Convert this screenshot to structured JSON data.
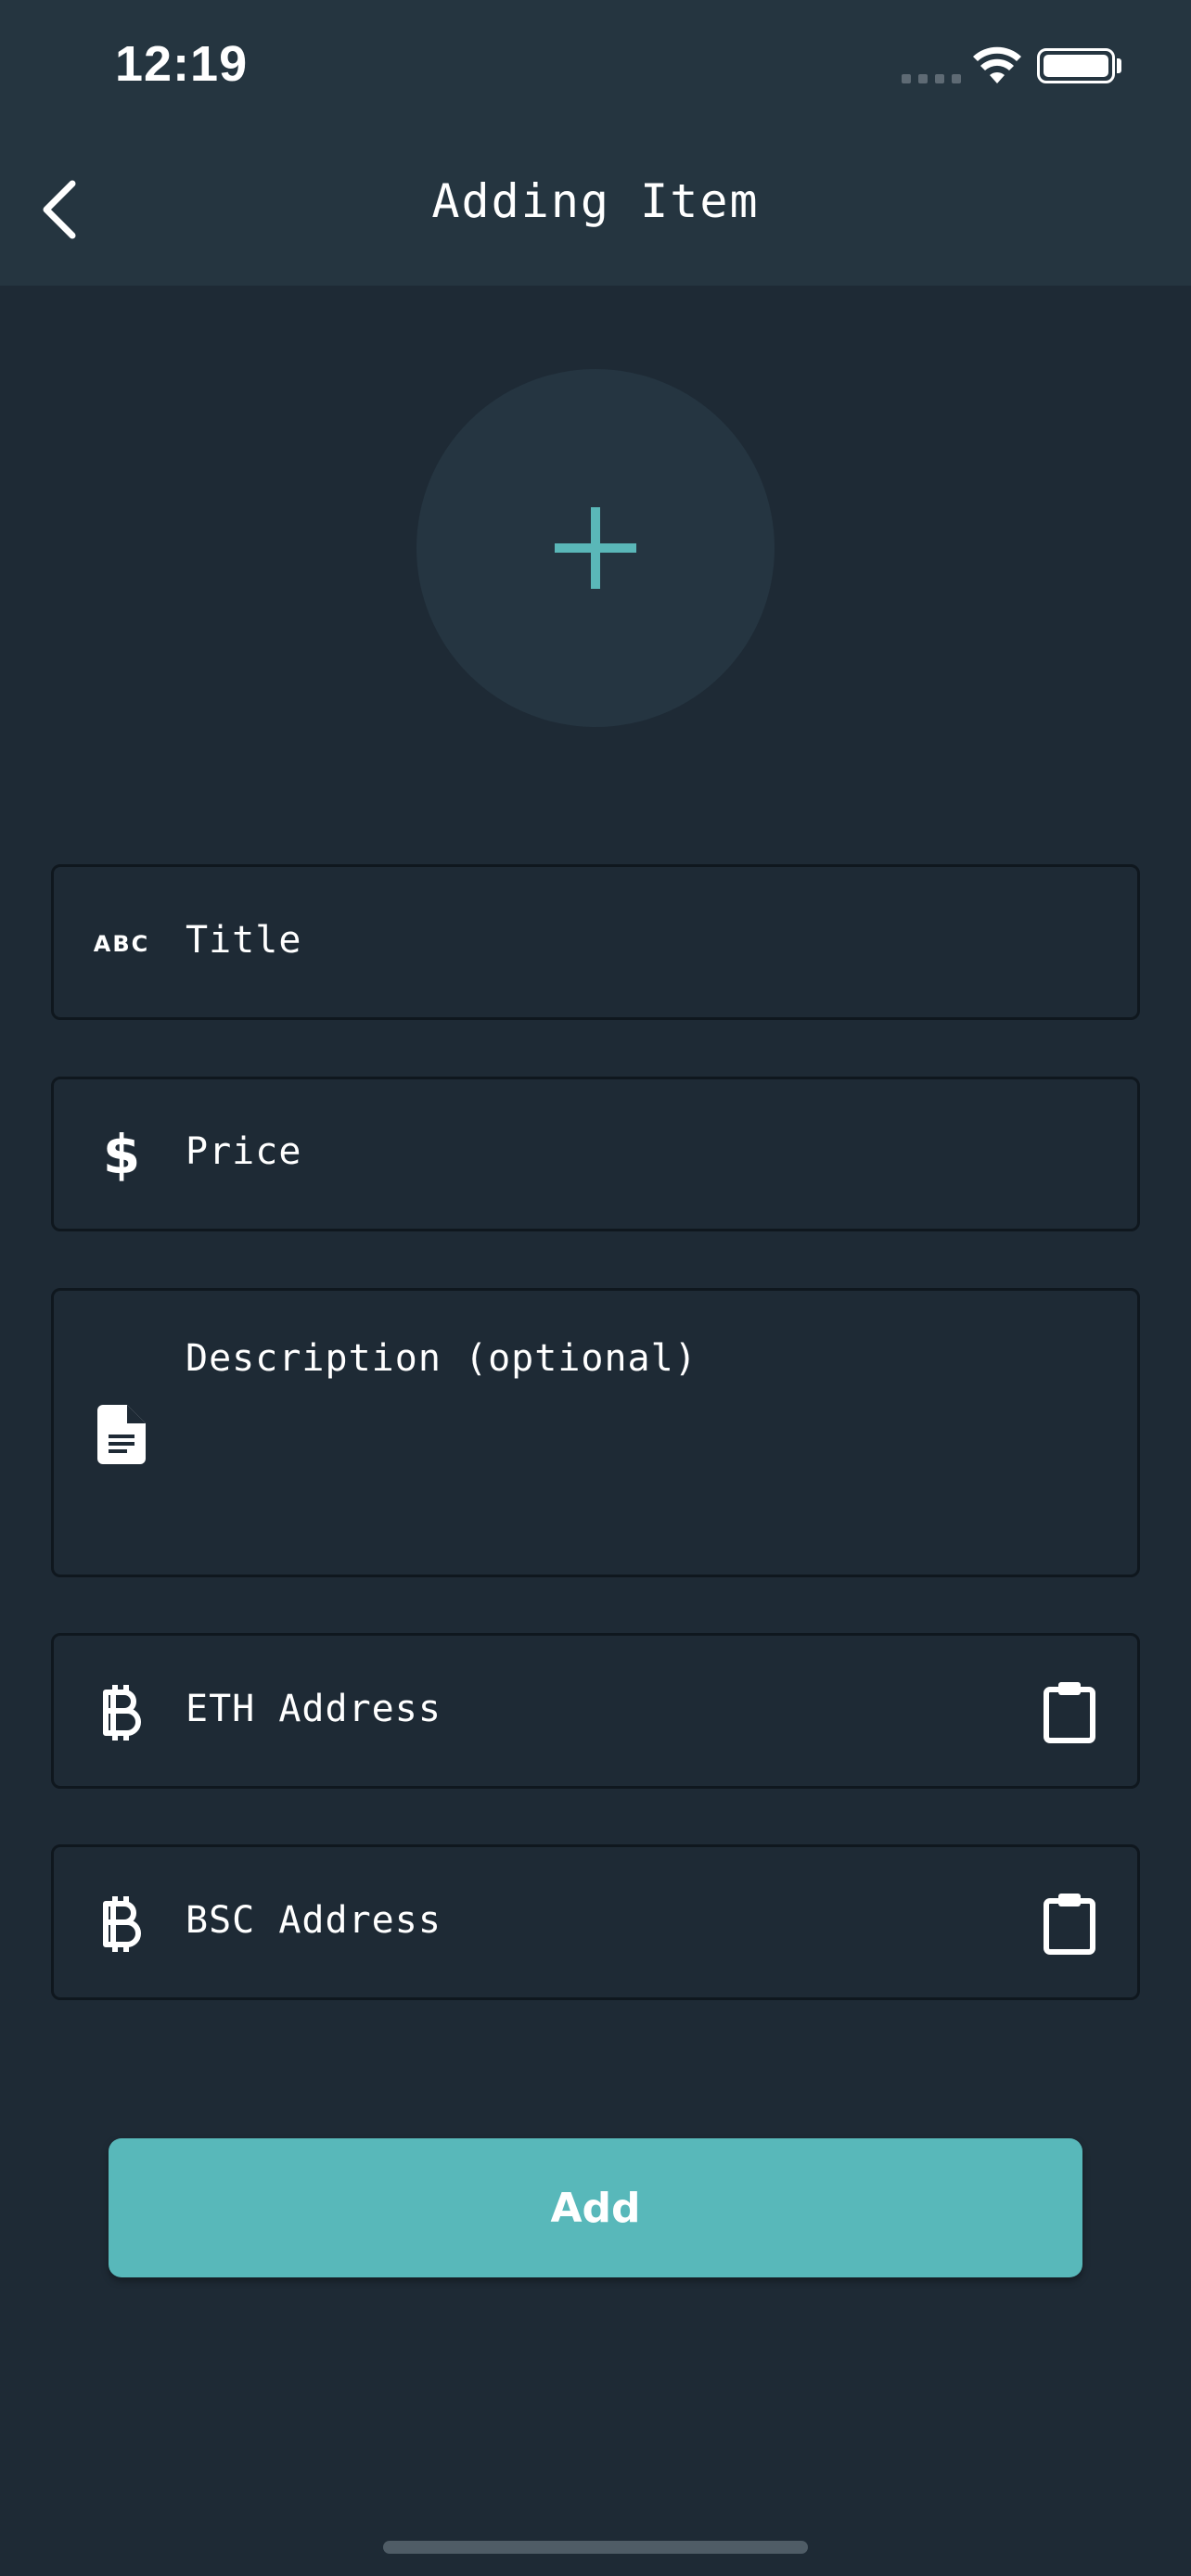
{
  "status_bar": {
    "time": "12:19"
  },
  "header": {
    "title": "Adding Item",
    "back_icon": "chevron-left-icon"
  },
  "image_picker": {
    "icon": "plus-icon",
    "accent_color": "#5ab7b8"
  },
  "form": {
    "fields": [
      {
        "label": "Title",
        "icon": "abc-icon",
        "icon_text": "ABC"
      },
      {
        "label": "Price",
        "icon": "dollar-icon",
        "icon_text": "$"
      },
      {
        "label": "Description (optional)",
        "icon": "document-icon"
      },
      {
        "label": "ETH Address",
        "icon": "bitcoin-icon",
        "action_icon": "clipboard-icon"
      },
      {
        "label": "BSC Address",
        "icon": "bitcoin-icon",
        "action_icon": "clipboard-icon"
      }
    ]
  },
  "actions": {
    "add_label": "Add",
    "add_color": "#58b8ba"
  },
  "colors": {
    "background": "#1e2a35",
    "header": "#253540",
    "field_border": "#0f171e"
  }
}
